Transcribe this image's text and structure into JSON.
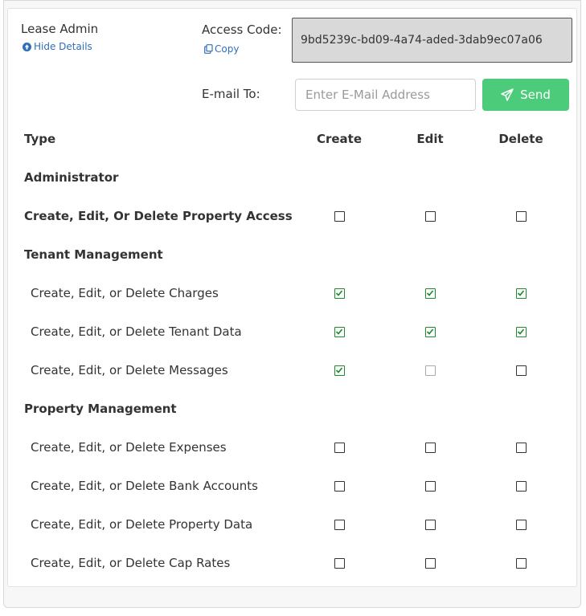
{
  "header": {
    "role_name": "Lease Admin",
    "hide_details_label": "Hide Details",
    "hide_details_icon": "arrow-circle-up-icon",
    "access_code_label": "Access Code:",
    "copy_label": "Copy",
    "copy_icon": "copy-icon",
    "access_code": "9bd5239c-bd09-4a74-aded-3dab9ec07a06",
    "email_label": "E-mail To:",
    "email_placeholder": "Enter E-Mail Address",
    "email_value": "",
    "send_label": "Send",
    "send_icon": "paper-plane-icon"
  },
  "colors": {
    "link": "#2f6fb7",
    "send_button": "#4ccb7a",
    "checked": "#1d8a2c",
    "code_box": "#d9d9d9"
  },
  "table": {
    "columns": [
      "Type",
      "Create",
      "Edit",
      "Delete"
    ],
    "rows": [
      {
        "kind": "section",
        "label": "Administrator"
      },
      {
        "kind": "item",
        "bold": true,
        "label": "Create, Edit, Or Delete Property Access",
        "create": "unchecked",
        "edit": "unchecked",
        "delete": "unchecked"
      },
      {
        "kind": "section",
        "label": "Tenant Management"
      },
      {
        "kind": "item",
        "bold": false,
        "label": "Create, Edit, or Delete Charges",
        "create": "checked",
        "edit": "checked",
        "delete": "checked"
      },
      {
        "kind": "item",
        "bold": false,
        "label": "Create, Edit, or Delete Tenant Data",
        "create": "checked",
        "edit": "checked",
        "delete": "checked"
      },
      {
        "kind": "item",
        "bold": false,
        "label": "Create, Edit, or Delete Messages",
        "create": "checked",
        "edit": "disabled",
        "delete": "unchecked"
      },
      {
        "kind": "section",
        "label": "Property Management"
      },
      {
        "kind": "item",
        "bold": false,
        "label": "Create, Edit, or Delete Expenses",
        "create": "unchecked",
        "edit": "unchecked",
        "delete": "unchecked"
      },
      {
        "kind": "item",
        "bold": false,
        "label": "Create, Edit, or Delete Bank Accounts",
        "create": "unchecked",
        "edit": "unchecked",
        "delete": "unchecked"
      },
      {
        "kind": "item",
        "bold": false,
        "label": "Create, Edit, or Delete Property Data",
        "create": "unchecked",
        "edit": "unchecked",
        "delete": "unchecked"
      },
      {
        "kind": "item",
        "bold": false,
        "label": "Create, Edit, or Delete Cap Rates",
        "create": "unchecked",
        "edit": "unchecked",
        "delete": "unchecked"
      }
    ]
  }
}
